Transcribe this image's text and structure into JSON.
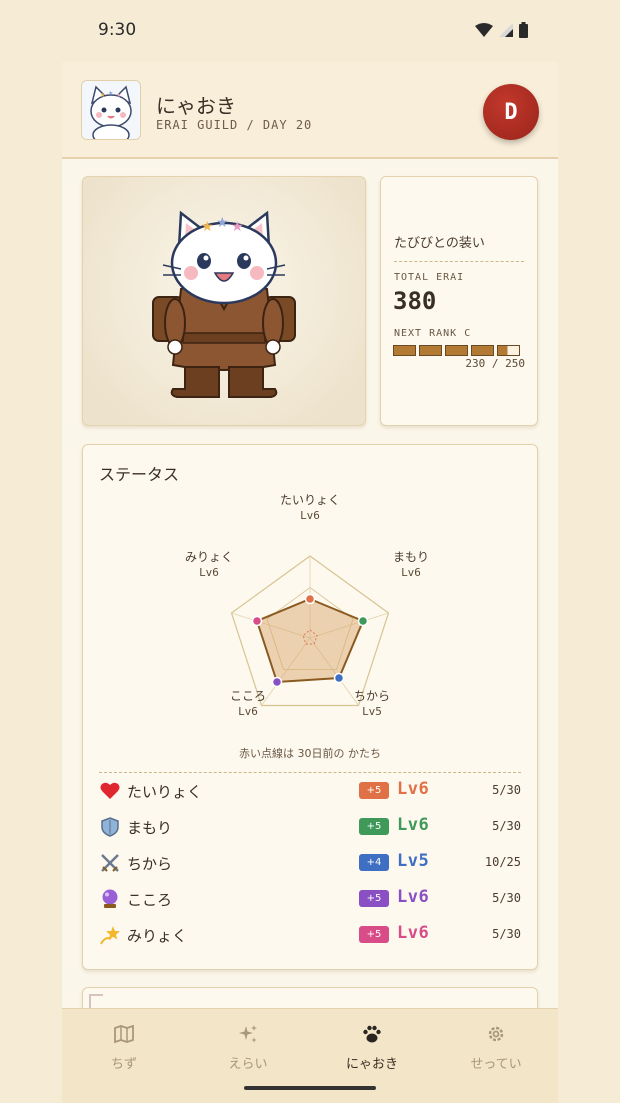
{
  "status_bar": {
    "time": "9:30"
  },
  "header": {
    "username": "にゃおき",
    "subtitle": "ERAI GUILD / DAY 20",
    "rank_badge": "D"
  },
  "character_info": {
    "outfit_name": "たびびとの装い",
    "total_erai_label": "TOTAL ERAI",
    "total_erai_value": "380",
    "next_rank_label": "NEXT RANK C",
    "progress_text": "230 / 250",
    "progress_fraction": 0.92
  },
  "status": {
    "title": "ステータス",
    "radar_labels": [
      {
        "name": "たいりょく",
        "level": "Lv6"
      },
      {
        "name": "まもり",
        "level": "Lv6"
      },
      {
        "name": "ちから",
        "level": "Lv5"
      },
      {
        "name": "こころ",
        "level": "Lv6"
      },
      {
        "name": "みりょく",
        "level": "Lv6"
      }
    ],
    "caption": "赤い点線は 30日前の かたち",
    "rows": [
      {
        "icon": "heart-icon",
        "name": "たいりょく",
        "gain": "+5",
        "level": "Lv6",
        "progress": "5/30",
        "color": "#e07045"
      },
      {
        "icon": "shield-icon",
        "name": "まもり",
        "gain": "+5",
        "level": "Lv6",
        "progress": "5/30",
        "color": "#3f9a5a"
      },
      {
        "icon": "swords-icon",
        "name": "ちから",
        "gain": "+4",
        "level": "Lv5",
        "progress": "10/25",
        "color": "#3f6fc2"
      },
      {
        "icon": "crystal-ball-icon",
        "name": "こころ",
        "gain": "+5",
        "level": "Lv6",
        "progress": "5/30",
        "color": "#8a4fc2"
      },
      {
        "icon": "dizzy-star-icon",
        "name": "みりょく",
        "gain": "+5",
        "level": "Lv6",
        "progress": "5/30",
        "color": "#d84c88"
      }
    ]
  },
  "nav": {
    "items": [
      {
        "label": "ちず",
        "icon": "map-icon"
      },
      {
        "label": "えらい",
        "icon": "sparkles-icon"
      },
      {
        "label": "にゃおき",
        "icon": "paw-icon"
      },
      {
        "label": "せってい",
        "icon": "gear-icon"
      }
    ],
    "active_index": 2
  }
}
